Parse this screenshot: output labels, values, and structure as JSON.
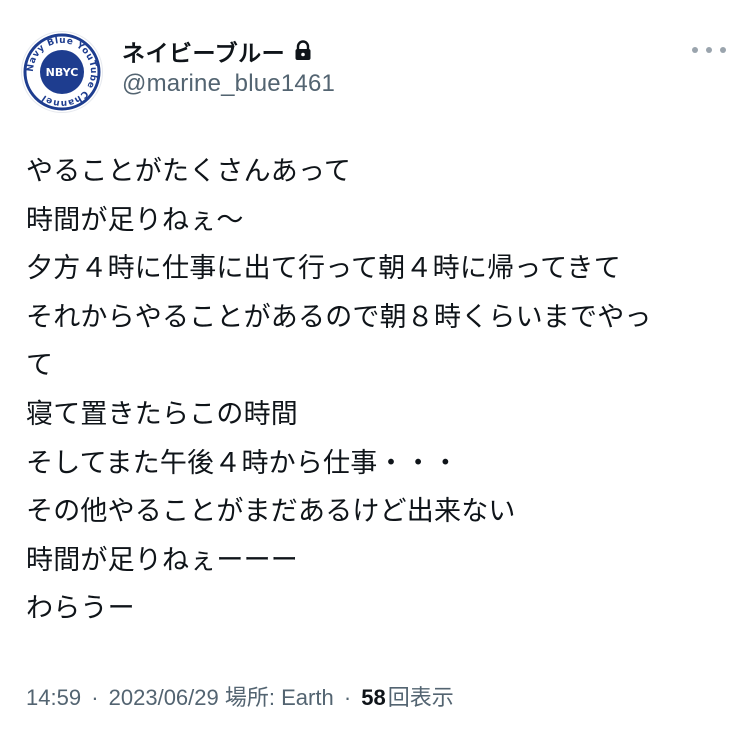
{
  "profile": {
    "avatar_icon": "nbyc-logo-icon",
    "avatar_ring_text": "Navy Blue YouTube Channel",
    "avatar_center_text": "NBYC",
    "display_name": "ネイビーブルー",
    "lock_icon": "lock-icon",
    "handle": "@marine_blue1461"
  },
  "menu": {
    "more_icon": "more-options-icon"
  },
  "tweet": {
    "lines": [
      "やることがたくさんあって",
      "時間が足りねぇ〜",
      "夕方４時に仕事に出て行って朝４時に帰ってきて",
      "それからやることがあるので朝８時くらいまでやっ",
      "て",
      "寝て置きたらこの時間",
      "そしてまた午後４時から仕事・・・",
      "その他やることがまだあるけど出来ない",
      "時間が足りねぇーーー",
      "わらうー"
    ]
  },
  "meta": {
    "time": "14:59",
    "separator": "·",
    "date": "2023/06/29",
    "location": "場所: Earth",
    "views_count": "58",
    "views_label": "回表示"
  },
  "colors": {
    "text_primary": "#0f1419",
    "text_secondary": "#536471",
    "avatar_navy": "#1e3d8f"
  }
}
